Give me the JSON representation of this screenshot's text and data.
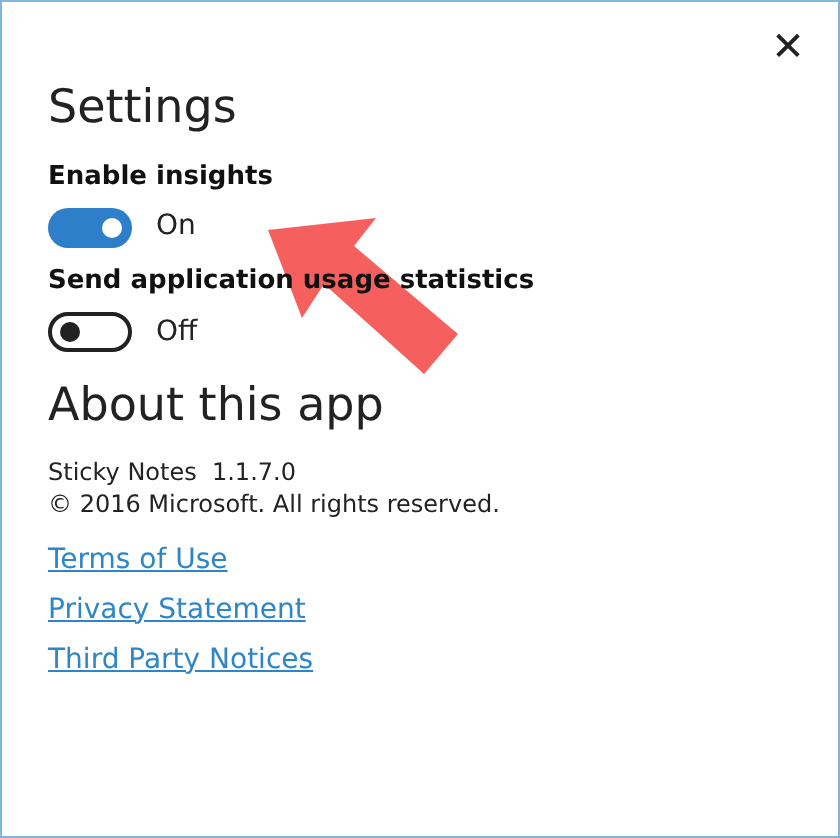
{
  "close_button": {
    "label": "✕"
  },
  "settings": {
    "title": "Settings",
    "toggles": [
      {
        "label": "Enable insights",
        "on": true,
        "state_text": "On"
      },
      {
        "label": "Send application usage statistics",
        "on": false,
        "state_text": "Off"
      }
    ]
  },
  "about": {
    "title": "About this app",
    "lines": [
      "Sticky Notes  1.1.7.0",
      "© 2016 Microsoft. All rights reserved."
    ],
    "links": [
      "Terms of Use",
      "Privacy Statement",
      "Third Party Notices"
    ]
  }
}
